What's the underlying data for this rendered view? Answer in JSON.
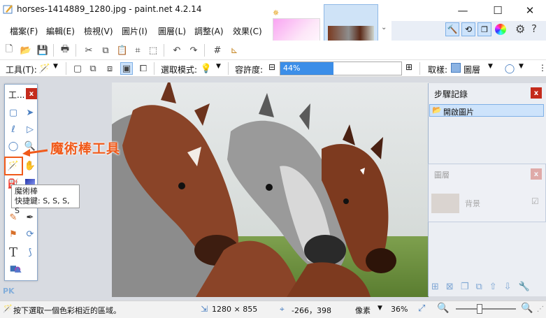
{
  "window": {
    "title": "horses-1414889_1280.jpg - paint.net 4.2.14",
    "minimize": "—",
    "maximize": "☐",
    "close": "✕"
  },
  "menu": [
    "檔案(F)",
    "編輯(E)",
    "檢視(V)",
    "圖片(I)",
    "圖層(L)",
    "調整(A)",
    "效果(C)"
  ],
  "toolbar2": {
    "tool_label": "工具(T):",
    "selection_mode_label": "選取模式:",
    "tolerance_label": "容許度:",
    "tolerance_value": "44%",
    "tolerance_fraction": 0.44,
    "sampling_label": "取樣:",
    "sampling_value": "圖層"
  },
  "tools_panel": {
    "title": "工...",
    "close": "x"
  },
  "tooltip": {
    "line1": "魔術棒",
    "line2": "快捷鍵: S, S, S, S"
  },
  "annotation": "魔術棒工具",
  "history_panel": {
    "title": "步驟記錄",
    "close": "x",
    "items": [
      "開啟圖片"
    ]
  },
  "layers_panel": {
    "title": "圖層",
    "close": "x",
    "layer_name": "背景"
  },
  "status": {
    "hint": "按下選取一個色彩相近的區域。",
    "image_size": "1280 × 855",
    "cursor_pos": "-266，398",
    "units": "像素",
    "zoom": "36%"
  },
  "watermark": "PK",
  "colors": {
    "accent": "#3c8ee8",
    "annotation": "#f05a1a",
    "close_red": "#c42b1c"
  }
}
